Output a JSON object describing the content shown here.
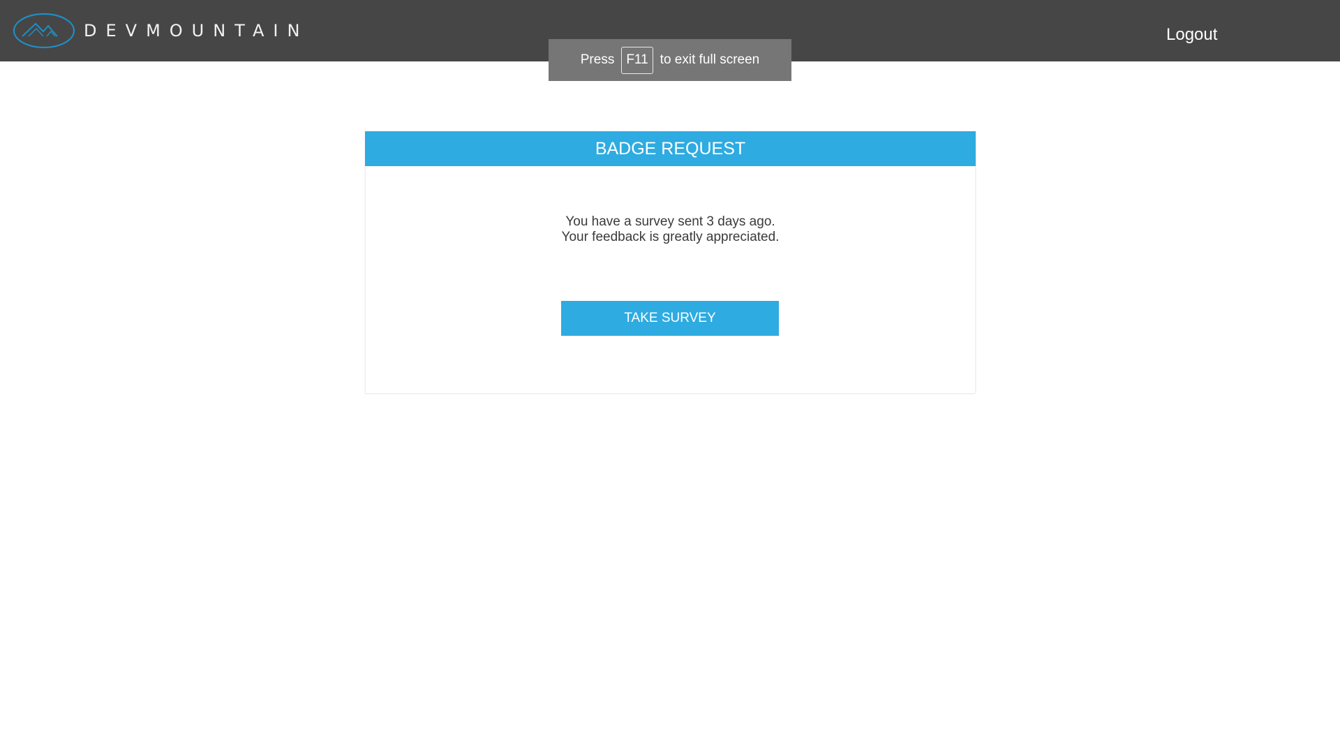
{
  "header": {
    "brand": "DEVMOUNTAIN",
    "logo_icon": "mountain-logo-icon",
    "logout_label": "Logout",
    "background_color": "#464646"
  },
  "fullscreen_notice": {
    "before": "Press",
    "key": "F11",
    "after": "to exit full screen"
  },
  "badge_request": {
    "title": "BADGE REQUEST",
    "message_line_1": "You have a survey sent 3 days ago.",
    "message_line_2": "Your feedback is greatly appreciated.",
    "button_label": "TAKE SURVEY",
    "accent_color": "#2eabe1"
  }
}
